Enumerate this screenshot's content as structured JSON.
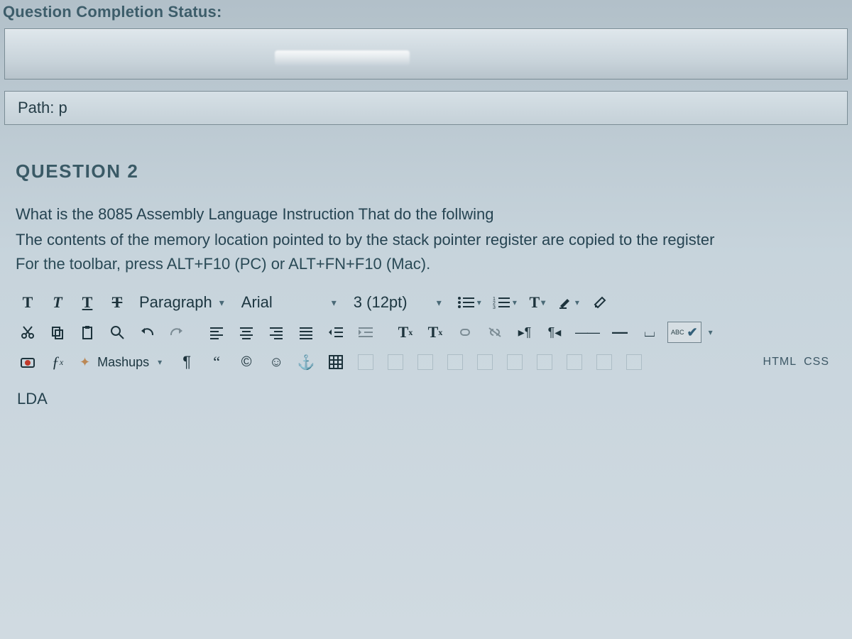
{
  "header": {
    "status_label": "Question Completion Status:"
  },
  "path_row": {
    "text": "Path: p"
  },
  "question": {
    "number_label": "QUESTION 2",
    "prompt_line1": "What is the 8085 Assembly Language Instruction That do the follwing",
    "prompt_line2": "The contents of the memory location pointed to by the stack pointer register are copied to the  register",
    "toolbar_hint": "For the toolbar, press ALT+F10 (PC) or ALT+FN+F10 (Mac)."
  },
  "toolbar": {
    "row1": {
      "bold": "T",
      "italic": "T",
      "underline": "T",
      "strikethrough": "T",
      "block_format": "Paragraph",
      "font_family": "Arial",
      "font_size": "3 (12pt)",
      "bullet_list": "",
      "number_list": "",
      "text_color": "T",
      "highlight": "",
      "clear_format": ""
    },
    "row2": {
      "cut": "",
      "copy": "",
      "paste": "",
      "find": "Q",
      "undo": "",
      "redo": "",
      "align_left": "",
      "align_center": "",
      "align_right": "",
      "align_justify": "",
      "outdent": "",
      "indent": "",
      "superscript": "Tˣ",
      "subscript": "Tₓ",
      "link": "",
      "unlink": "",
      "ltr": "¶",
      "rtl": "¶",
      "hr_thin": "—",
      "hr_thick": "—",
      "nbsp": "⌴",
      "spellcheck_label": "ABC"
    },
    "row3": {
      "record": "",
      "fx": "ƒₓ",
      "mashups": "Mashups",
      "show_marks": "¶",
      "quote": "❝",
      "copyright": "©",
      "emoji": "☺",
      "anchor": "⚓",
      "table": "",
      "html_label": "HTML",
      "css_label": "CSS"
    }
  },
  "editor": {
    "content": "LDA"
  }
}
